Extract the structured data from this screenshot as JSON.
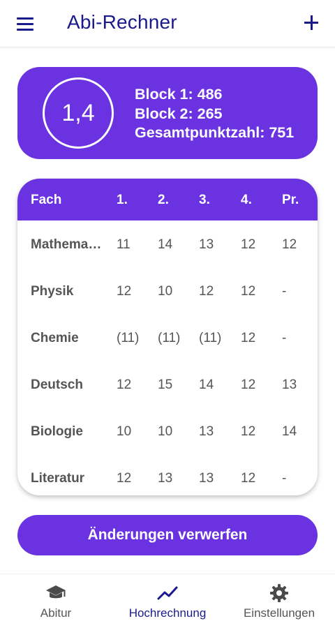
{
  "appbar": {
    "title": "Abi-Rechner",
    "menu_icon": "menu-icon",
    "add_icon": "add-icon"
  },
  "summary": {
    "grade": "1,4",
    "block1": "Block 1: 486",
    "block2": "Block 2: 265",
    "total": "Gesamtpunktzahl: 751"
  },
  "table": {
    "headers": [
      "Fach",
      "1.",
      "2.",
      "3.",
      "4.",
      "Pr."
    ],
    "rows": [
      {
        "subject": "Mathematik",
        "display": "Mathema…",
        "cells": [
          "11",
          "14",
          "13",
          "12",
          "12"
        ]
      },
      {
        "subject": "Physik",
        "display": "Physik",
        "cells": [
          "12",
          "10",
          "12",
          "12",
          "-"
        ]
      },
      {
        "subject": "Chemie",
        "display": "Chemie",
        "cells": [
          "(11)",
          "(11)",
          "(11)",
          "12",
          "-"
        ]
      },
      {
        "subject": "Deutsch",
        "display": "Deutsch",
        "cells": [
          "12",
          "15",
          "14",
          "12",
          "13"
        ]
      },
      {
        "subject": "Biologie",
        "display": "Biologie",
        "cells": [
          "10",
          "10",
          "13",
          "12",
          "14"
        ]
      },
      {
        "subject": "Literatur",
        "display": "Literatur",
        "cells": [
          "12",
          "13",
          "13",
          "12",
          "-"
        ]
      }
    ]
  },
  "discard_button": "Änderungen verwerfen",
  "bottom_nav": [
    {
      "label": "Abitur",
      "icon": "graduation-cap-icon",
      "active": false
    },
    {
      "label": "Hochrechnung",
      "icon": "trending-icon",
      "active": true
    },
    {
      "label": "Einstellungen",
      "icon": "gear-icon",
      "active": false
    }
  ],
  "colors": {
    "primary": "#6a32e0",
    "appbar_text": "#1a1a8c",
    "text_gray": "#555555",
    "icon_gray": "#4a4a4a"
  }
}
